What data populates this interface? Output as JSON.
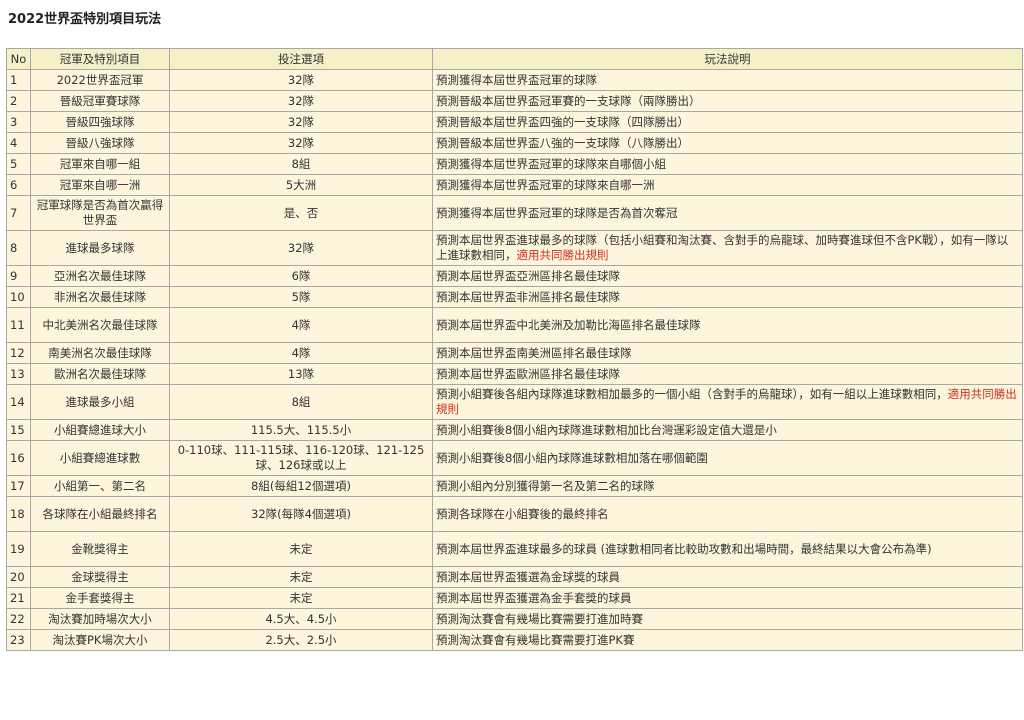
{
  "page": {
    "title": "2022世界盃特別項目玩法"
  },
  "table": {
    "headers": {
      "no": "No",
      "item": "冠軍及特別項目",
      "options": "投注選項",
      "desc": "玩法說明"
    },
    "rows": [
      {
        "no": "1",
        "item": "2022世界盃冠軍",
        "options": "32隊",
        "desc": "預測獲得本屆世界盃冠軍的球隊",
        "note": ""
      },
      {
        "no": "2",
        "item": "晉級冠軍賽球隊",
        "options": "32隊",
        "desc": "預測晉級本屆世界盃冠軍賽的一支球隊（兩隊勝出）",
        "note": ""
      },
      {
        "no": "3",
        "item": "晉級四強球隊",
        "options": "32隊",
        "desc": "預測晉級本屆世界盃四強的一支球隊（四隊勝出）",
        "note": ""
      },
      {
        "no": "4",
        "item": "晉級八強球隊",
        "options": "32隊",
        "desc": "預測晉級本屆世界盃八強的一支球隊（八隊勝出）",
        "note": ""
      },
      {
        "no": "5",
        "item": "冠軍來自哪一組",
        "options": "8組",
        "desc": "預測獲得本屆世界盃冠軍的球隊來自哪個小組",
        "note": ""
      },
      {
        "no": "6",
        "item": "冠軍來自哪一洲",
        "options": "5大洲",
        "desc": "預測獲得本屆世界盃冠軍的球隊來自哪一洲",
        "note": ""
      },
      {
        "no": "7",
        "item": "冠軍球隊是否為首次贏得世界盃",
        "options": "是、否",
        "desc": "預測獲得本屆世界盃冠軍的球隊是否為首次奪冠",
        "note": ""
      },
      {
        "no": "8",
        "item": "進球最多球隊",
        "options": "32隊",
        "desc": "預測本屆世界盃進球最多的球隊（包括小組賽和淘汰賽、含對手的烏龍球、加時賽進球但不含PK戰），如有一隊以上進球數相同，",
        "note": "適用共同勝出規則"
      },
      {
        "no": "9",
        "item": "亞洲名次最佳球隊",
        "options": "6隊",
        "desc": "預測本屆世界盃亞洲區排名最佳球隊",
        "note": ""
      },
      {
        "no": "10",
        "item": "非洲名次最佳球隊",
        "options": "5隊",
        "desc": "預測本屆世界盃非洲區排名最佳球隊",
        "note": ""
      },
      {
        "no": "11",
        "item": "中北美洲名次最佳球隊",
        "options": "4隊",
        "desc": "預測本屆世界盃中北美洲及加勒比海區排名最佳球隊",
        "note": ""
      },
      {
        "no": "12",
        "item": "南美洲名次最佳球隊",
        "options": "4隊",
        "desc": "預測本屆世界盃南美洲區排名最佳球隊",
        "note": ""
      },
      {
        "no": "13",
        "item": "歐洲名次最佳球隊",
        "options": "13隊",
        "desc": "預測本屆世界盃歐洲區排名最佳球隊",
        "note": ""
      },
      {
        "no": "14",
        "item": "進球最多小組",
        "options": "8組",
        "desc": "預測小組賽後各組內球隊進球數相加最多的一個小組（含對手的烏龍球），如有一組以上進球數相同，",
        "note": "適用共同勝出規則"
      },
      {
        "no": "15",
        "item": "小組賽總進球大小",
        "options": "115.5大、115.5小",
        "desc": "預測小組賽後8個小組內球隊進球數相加比台灣運彩設定值大還是小",
        "note": ""
      },
      {
        "no": "16",
        "item": "小組賽總進球數",
        "options": "0-110球、111-115球、116-120球、121-125球、126球或以上",
        "desc": "預測小組賽後8個小組內球隊進球數相加落在哪個範圍",
        "note": ""
      },
      {
        "no": "17",
        "item": "小組第一、第二名",
        "options": "8組(每組12個選項)",
        "desc": "預測小組內分別獲得第一名及第二名的球隊",
        "note": ""
      },
      {
        "no": "18",
        "item": "各球隊在小組最終排名",
        "options": "32隊(每隊4個選項)",
        "desc": "預測各球隊在小組賽後的最終排名",
        "note": ""
      },
      {
        "no": "19",
        "item": "金靴獎得主",
        "options": "未定",
        "desc": "預測本屆世界盃進球最多的球員 (進球數相同者比較助攻數和出場時間，最終結果以大會公布為準)",
        "note": ""
      },
      {
        "no": "20",
        "item": "金球獎得主",
        "options": "未定",
        "desc": "預測本屆世界盃獲選為金球獎的球員",
        "note": ""
      },
      {
        "no": "21",
        "item": "金手套獎得主",
        "options": "未定",
        "desc": "預測本屆世界盃獲選為金手套獎的球員",
        "note": ""
      },
      {
        "no": "22",
        "item": "淘汰賽加時場次大小",
        "options": "4.5大、4.5小",
        "desc": "預測淘汰賽會有幾場比賽需要打進加時賽",
        "note": ""
      },
      {
        "no": "23",
        "item": "淘汰賽PK場次大小",
        "options": "2.5大、2.5小",
        "desc": "預測淘汰賽會有幾場比賽需要打進PK賽",
        "note": ""
      }
    ]
  }
}
